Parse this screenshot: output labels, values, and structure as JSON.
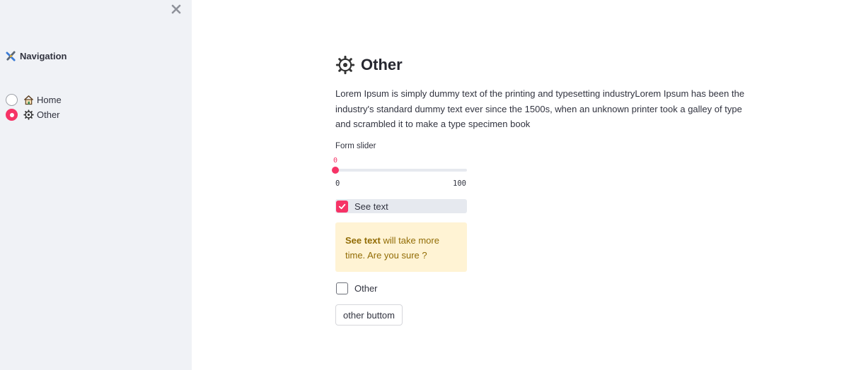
{
  "sidebar": {
    "title": "Navigation",
    "title_icon": "compass-tools-icon",
    "options": [
      {
        "icon": "house-icon",
        "label": "Home",
        "selected": false
      },
      {
        "icon": "gear-icon",
        "label": "Other",
        "selected": true
      }
    ]
  },
  "main": {
    "title": "Other",
    "title_icon": "gear-icon",
    "description": "Lorem Ipsum is simply dummy text of the printing and typesetting industryLorem Ipsum has been the industry's standard dummy text ever since the 1500s, when an unknown printer took a galley of type and scrambled it to make a type specimen book",
    "slider": {
      "label": "Form slider",
      "value": "0",
      "min": "0",
      "max": "100"
    },
    "checkbox_see_text": {
      "label": "See text",
      "checked": true
    },
    "warning": {
      "bold": "See text",
      "rest": " will take more time. Are you sure ?"
    },
    "checkbox_other": {
      "label": "Other",
      "checked": false
    },
    "button_label": "other buttom"
  },
  "colors": {
    "accent": "#f63366",
    "sidebar_bg": "#f0f2f6",
    "warning_bg": "#fff3d4"
  }
}
